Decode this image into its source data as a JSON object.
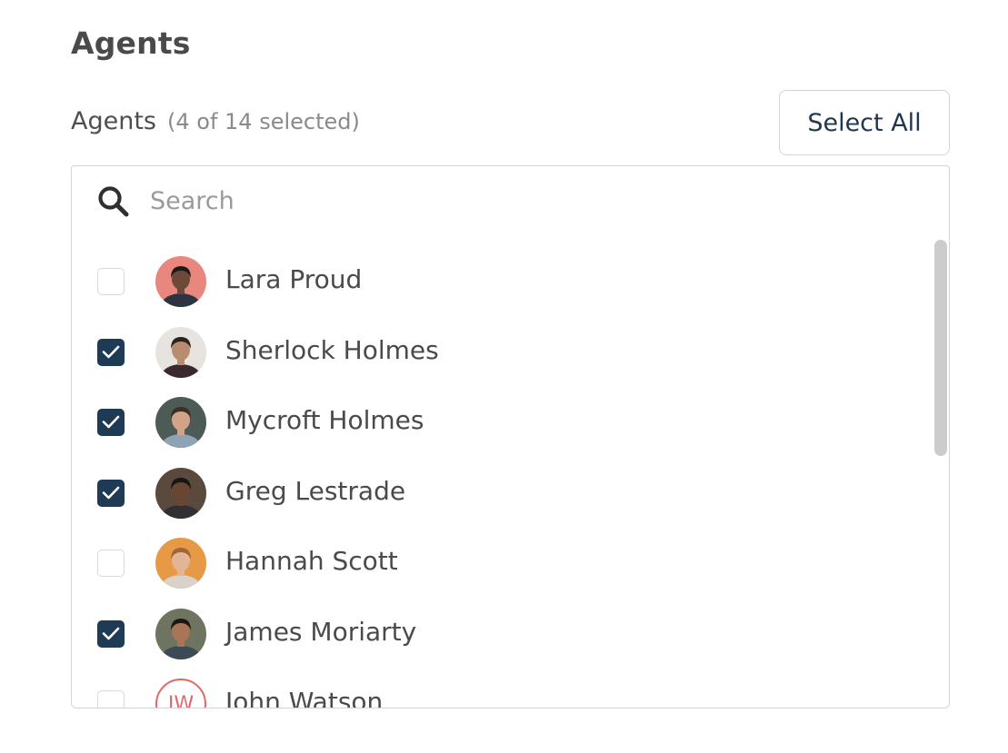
{
  "panel": {
    "title": "Agents"
  },
  "field": {
    "label": "Agents",
    "count_text": "(4 of 14 selected)",
    "select_all_label": "Select All"
  },
  "search": {
    "placeholder": "Search",
    "value": "",
    "icon": "search-icon"
  },
  "agents": [
    {
      "name": "Lara Proud",
      "selected": false,
      "avatar": "photo",
      "avatar_bg": "#e8877d",
      "skin": "#6b4a3a",
      "hair": "#1e1a1a",
      "shirt": "#2b3440"
    },
    {
      "name": "Sherlock Holmes",
      "selected": true,
      "avatar": "photo",
      "avatar_bg": "#e7e3df",
      "skin": "#b98c70",
      "hair": "#2a2420",
      "shirt": "#3a2a30"
    },
    {
      "name": "Mycroft Holmes",
      "selected": true,
      "avatar": "photo",
      "avatar_bg": "#4c5b55",
      "skin": "#d1a487",
      "hair": "#3a2e25",
      "shirt": "#8ea4b4"
    },
    {
      "name": "Greg Lestrade",
      "selected": true,
      "avatar": "photo",
      "avatar_bg": "#5a4a3e",
      "skin": "#6a4532",
      "hair": "#1a1412",
      "shirt": "#2f2f34"
    },
    {
      "name": "Hannah Scott",
      "selected": false,
      "avatar": "photo",
      "avatar_bg": "#e79a45",
      "skin": "#e3b597",
      "hair": "#a0653a",
      "shirt": "#d9d2c8"
    },
    {
      "name": "James Moriarty",
      "selected": true,
      "avatar": "photo",
      "avatar_bg": "#6d7560",
      "skin": "#a87656",
      "hair": "#1b1715",
      "shirt": "#3c4a55"
    },
    {
      "name": "John Watson",
      "selected": false,
      "avatar": "initials",
      "initials": "JW",
      "accent": "#e06a6a"
    }
  ],
  "colors": {
    "checkbox_checked": "#1f3a54",
    "button_text": "#1e3650",
    "border": "#d4d4d4",
    "scrollbar": "#cccccc"
  }
}
